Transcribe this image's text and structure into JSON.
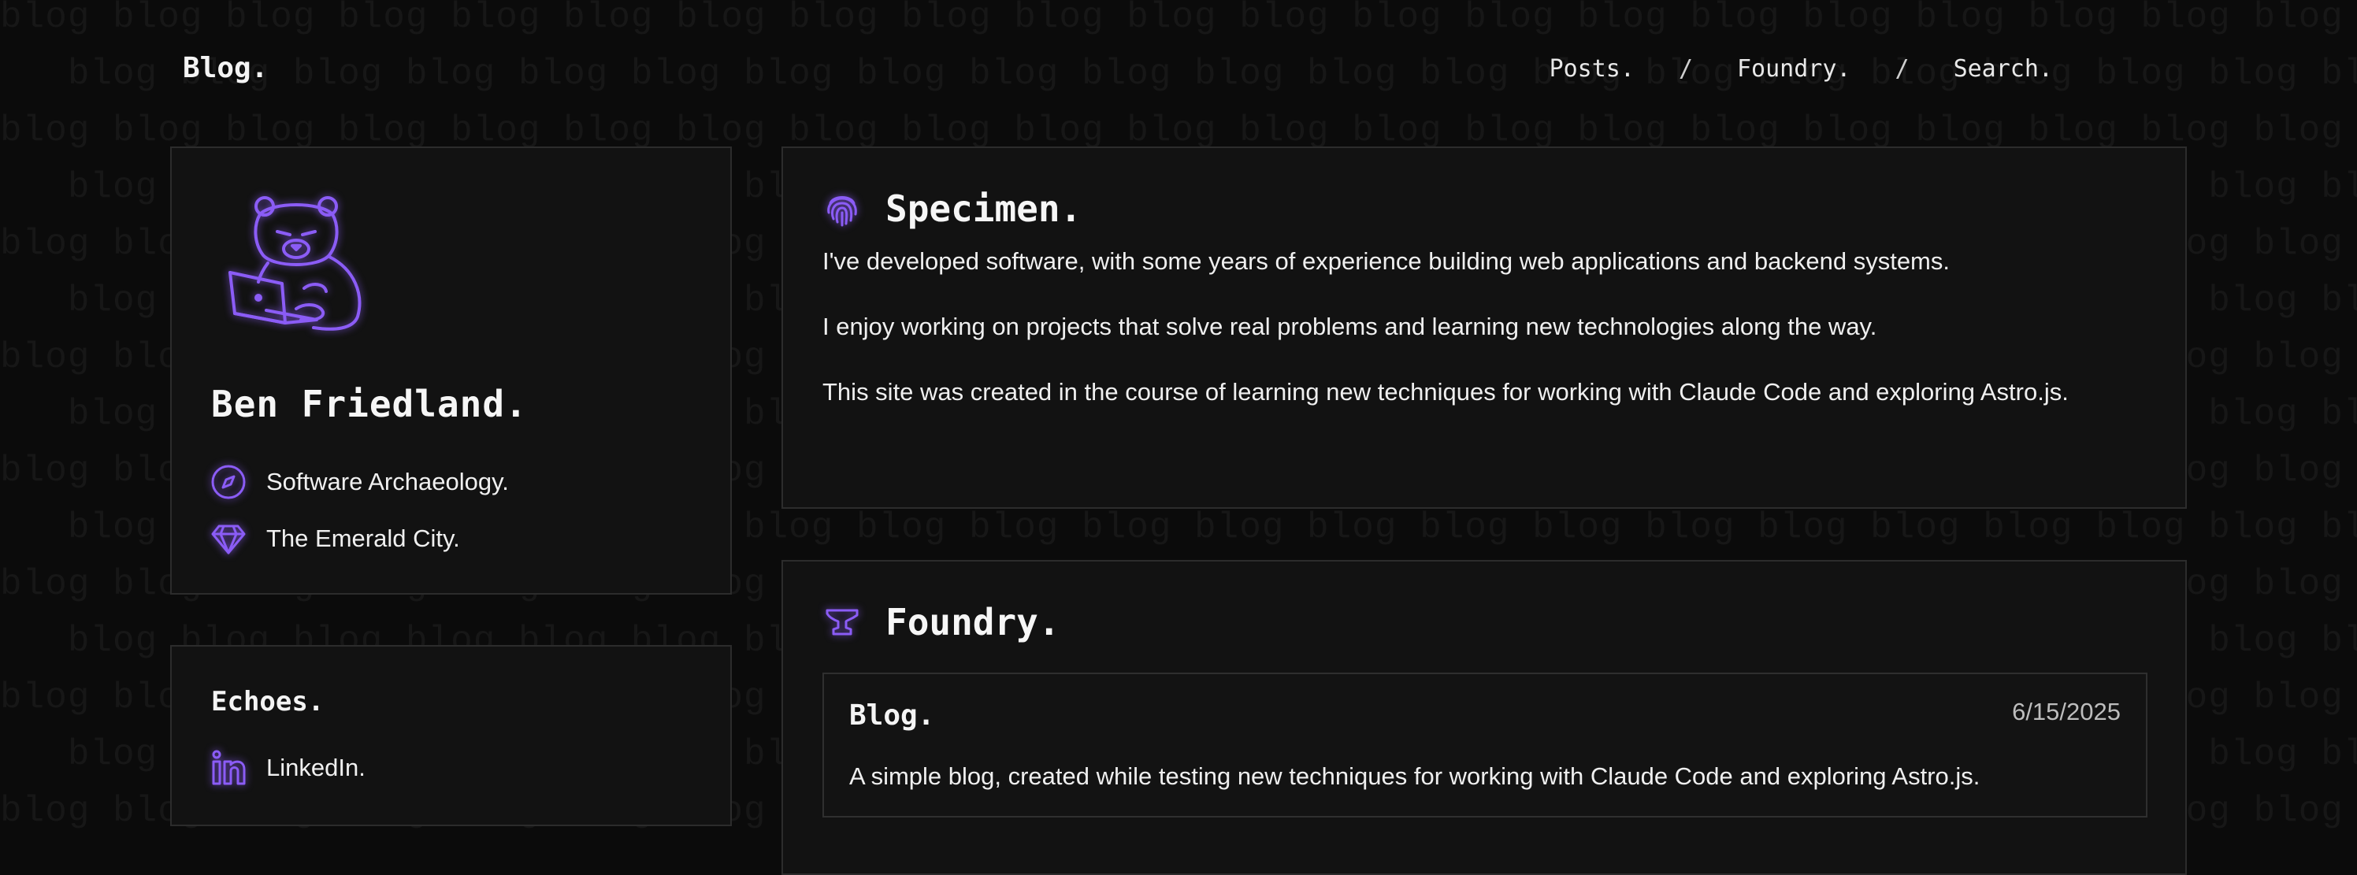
{
  "brand": "Blog.",
  "nav": {
    "posts": "Posts.",
    "foundry": "Foundry.",
    "search": "Search.",
    "separator": "/"
  },
  "profile": {
    "name": "Ben Friedland.",
    "role": "Software Archaeology.",
    "location": "The Emerald City."
  },
  "echoes": {
    "title": "Echoes.",
    "linkedin": "LinkedIn."
  },
  "specimen": {
    "title": "Specimen.",
    "paragraphs": [
      "I've developed software, with some years of experience building web applications and backend systems.",
      "I enjoy working on projects that solve real problems and learning new technologies along the way.",
      "This site was created in the course of learning new techniques for working with Claude Code and exploring Astro.js."
    ]
  },
  "foundry": {
    "title": "Foundry.",
    "post": {
      "title": "Blog.",
      "date": "6/15/2025",
      "description": "A simple blog, created while testing new techniques for working with Claude Code and exploring Astro.js."
    }
  },
  "colors": {
    "accent": "#8b5cf6",
    "background": "#0b0b0b",
    "card": "#121212",
    "border": "#2c2c2c"
  },
  "icons": [
    "bear-laptop-avatar",
    "compass-icon",
    "gem-icon",
    "linkedin-icon",
    "fingerprint-icon",
    "anvil-icon"
  ]
}
